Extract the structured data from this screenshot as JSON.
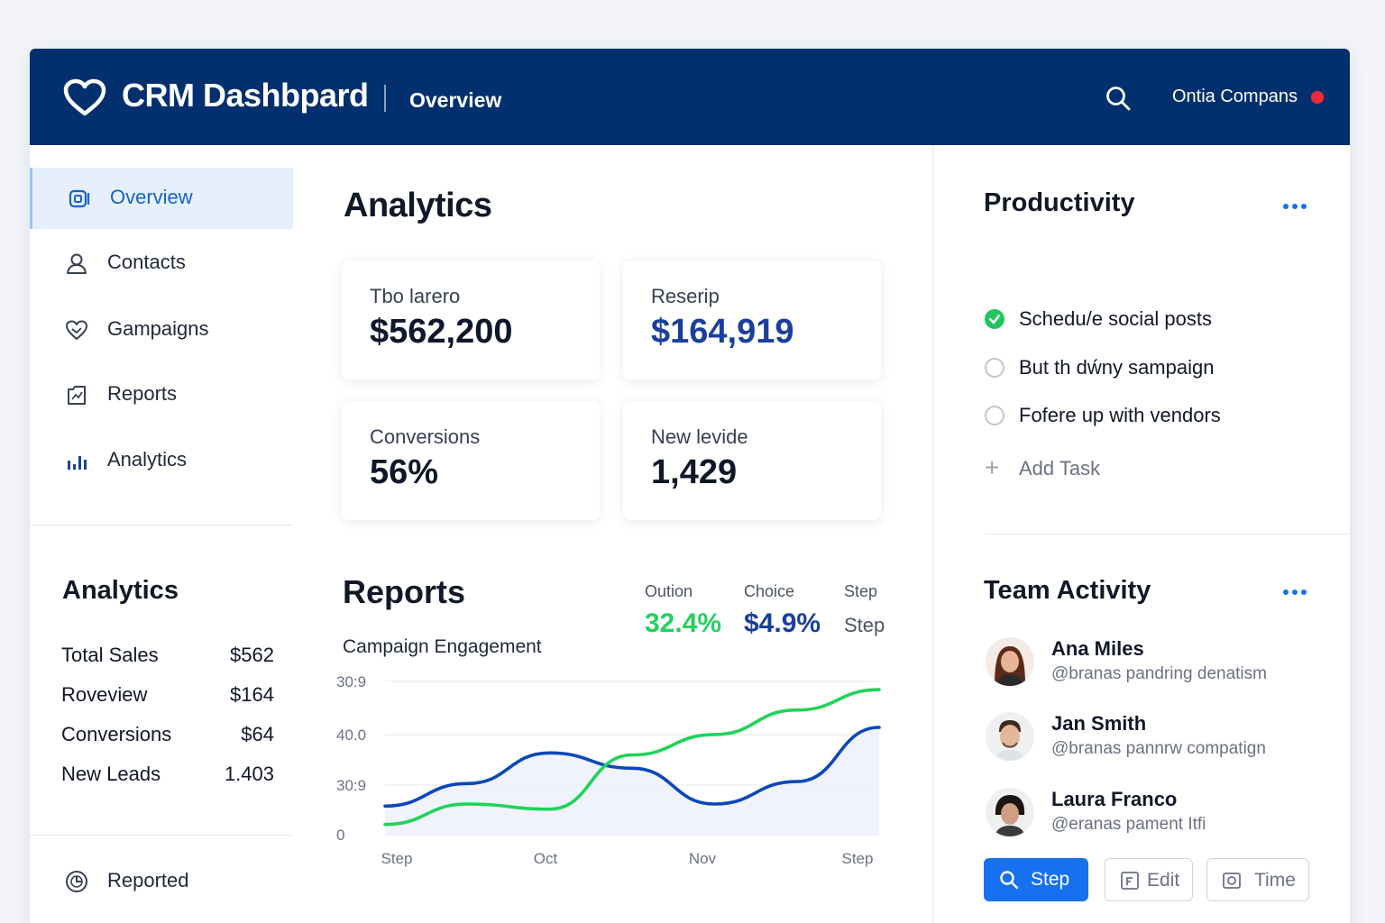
{
  "header": {
    "app_title": "CRM Dashbpard",
    "tab": "Overview",
    "company": "Ontia Compans",
    "status_color": "#ef2a3a",
    "brand_color": "#02306e"
  },
  "sidebar": {
    "items": [
      {
        "label": "Overview",
        "icon": "overview-icon",
        "active": true
      },
      {
        "label": "Contacts",
        "icon": "user-icon"
      },
      {
        "label": "Gampaigns",
        "icon": "heart-icon"
      },
      {
        "label": "Reports",
        "icon": "report-icon"
      },
      {
        "label": "Analytics",
        "icon": "bar-chart-icon"
      }
    ],
    "analytics": {
      "title": "Analytics",
      "rows": [
        {
          "label": "Total Sales",
          "value": "$562"
        },
        {
          "label": "Roveview",
          "value": "$164"
        },
        {
          "label": "Conversions",
          "value": "$64"
        },
        {
          "label": "New Leads",
          "value": "1.403"
        }
      ]
    },
    "reported": {
      "label": "Reported",
      "icon": "clock-icon"
    }
  },
  "main": {
    "title": "Analytics",
    "kpis": [
      {
        "label": "Tbo larero",
        "value": "$562,200"
      },
      {
        "label": "Reserip",
        "value": "$164,919"
      },
      {
        "label": "Conversions",
        "value": "56%"
      },
      {
        "label": "New levide",
        "value": "1,429"
      }
    ],
    "reports": {
      "title": "Reports",
      "subtitle": "Campaign Engagement",
      "metrics": [
        {
          "label": "Oution",
          "value": "32.4%",
          "color": "#22d15c"
        },
        {
          "label": "Choice",
          "value": "$4.9%",
          "color": "#1a3f9c"
        },
        {
          "label": "Step",
          "value": "Step",
          "color": "#4b5563"
        }
      ]
    }
  },
  "chart_data": {
    "type": "line",
    "title": "",
    "subtitle": "Campaign Engagement",
    "x_ticks": [
      "Step",
      "Oct",
      "Nov",
      "Step"
    ],
    "y_ticks": [
      "30:9",
      "40.0",
      "30:9",
      "0"
    ],
    "series": [
      {
        "color": "#0b47b8",
        "x": [
          0,
          0.5,
          1,
          1.5,
          2,
          2.5,
          3
        ],
        "y": [
          0.28,
          0.5,
          0.8,
          0.65,
          0.3,
          0.52,
          1.05
        ],
        "area": true
      },
      {
        "color": "#1fd35a",
        "x": [
          0,
          0.5,
          1,
          1.5,
          2,
          2.5,
          3
        ],
        "y": [
          0.1,
          0.3,
          0.25,
          0.78,
          0.98,
          1.22,
          1.42
        ]
      }
    ],
    "grid": true
  },
  "productivity": {
    "title": "Productivity",
    "tasks": [
      {
        "label": "Schedu/e social posts",
        "done": true
      },
      {
        "label": "But th dẃny sampaign",
        "done": false
      },
      {
        "label": "Fofere up with vendors",
        "done": false
      }
    ],
    "add_task": "Add Task"
  },
  "team": {
    "title": "Team Activity",
    "members": [
      {
        "name": "Ana Miles",
        "handle": "@branas pandring denatism"
      },
      {
        "name": "Jan Smith",
        "handle": "@branas pannrw compatign"
      },
      {
        "name": "Laura Franco",
        "handle": "@eranas pament Itfi"
      }
    ],
    "buttons": [
      {
        "label": "Step",
        "icon": "search-icon"
      },
      {
        "label": "Edit",
        "icon": "edit-icon"
      },
      {
        "label": "Time",
        "icon": "camera-icon"
      }
    ]
  }
}
